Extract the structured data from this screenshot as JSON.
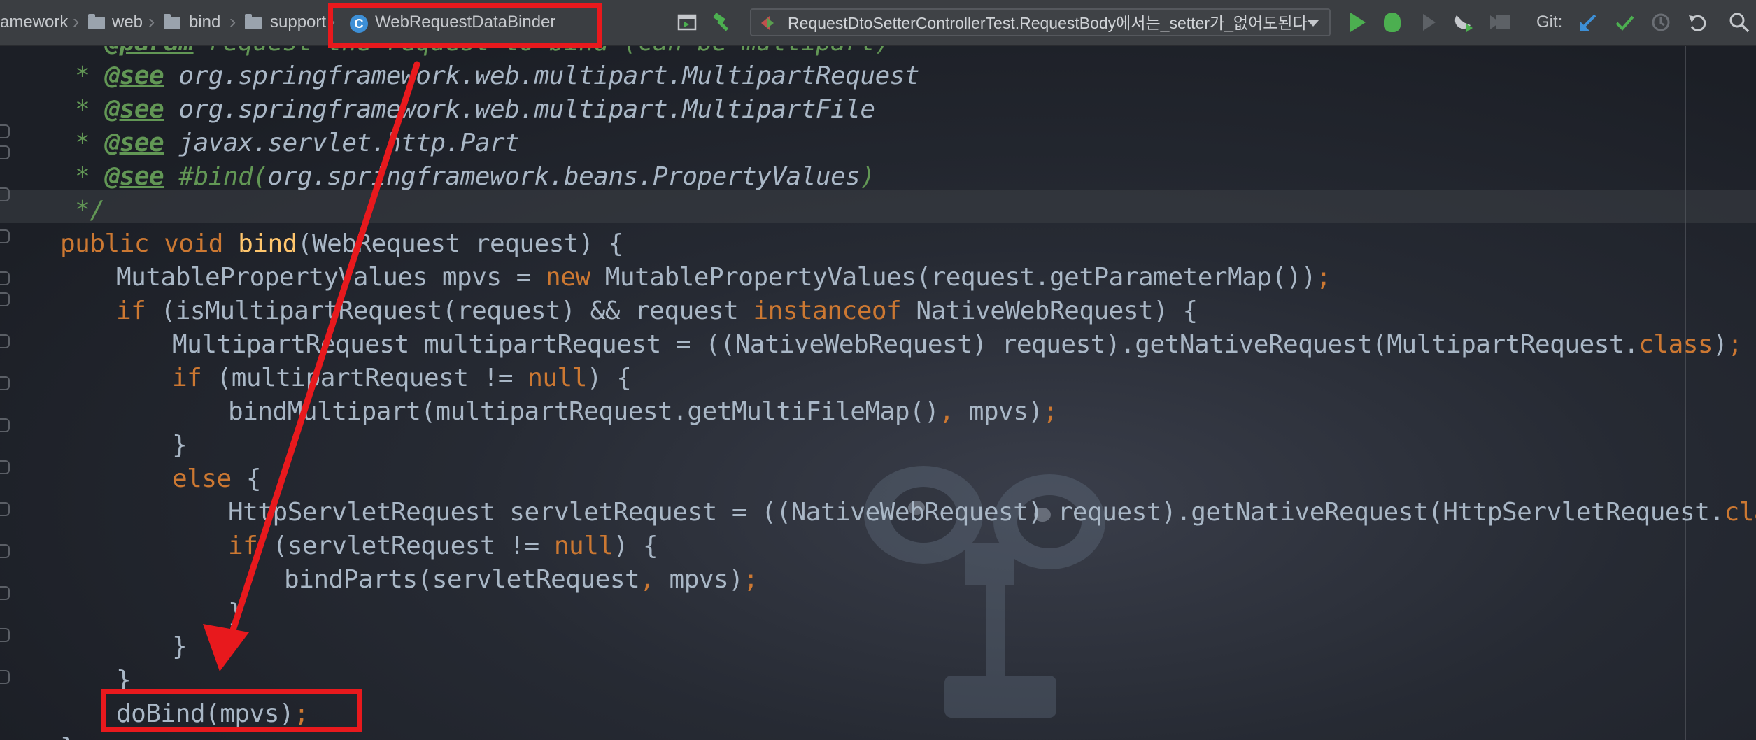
{
  "breadcrumbs": [
    {
      "label": "amework",
      "folder": false
    },
    {
      "label": "web",
      "folder": true
    },
    {
      "label": "bind",
      "folder": true
    },
    {
      "label": "support",
      "folder": true
    }
  ],
  "active_class": {
    "label": "WebRequestDataBinder",
    "icon": "class-icon",
    "icon_glyph": "C"
  },
  "toolbar": {
    "run_configuration": "RequestDtoSetterControllerTest.RequestBody에서는_setter가_없어도된다",
    "git_label": "Git:",
    "icons": [
      "layout-icon",
      "build-hammer-icon",
      "run-icon",
      "debug-icon",
      "run-coverage-icon",
      "profile-icon",
      "stop-icon",
      "git-update-icon",
      "git-commit-icon",
      "history-icon",
      "revert-icon",
      "search-icon"
    ]
  },
  "code_lines": [
    {
      "indent": 1,
      "tokens": [
        {
          "t": " * ",
          "c": "doc"
        },
        {
          "t": "@param",
          "c": "tag"
        },
        {
          "t": " request the request to bind (can be multipart)",
          "c": "doc"
        }
      ]
    },
    {
      "indent": 1,
      "tokens": [
        {
          "t": " * ",
          "c": "doc"
        },
        {
          "t": "@see",
          "c": "tag"
        },
        {
          "t": " org.springframework.web.multipart.MultipartRequest",
          "c": "ref"
        }
      ]
    },
    {
      "indent": 1,
      "tokens": [
        {
          "t": " * ",
          "c": "doc"
        },
        {
          "t": "@see",
          "c": "tag"
        },
        {
          "t": " org.springframework.web.multipart.MultipartFile",
          "c": "ref"
        }
      ]
    },
    {
      "indent": 1,
      "tokens": [
        {
          "t": " * ",
          "c": "doc"
        },
        {
          "t": "@see",
          "c": "tag"
        },
        {
          "t": " javax.servlet.http.Part",
          "c": "ref"
        }
      ]
    },
    {
      "indent": 1,
      "tokens": [
        {
          "t": " * ",
          "c": "doc"
        },
        {
          "t": "@see",
          "c": "tag"
        },
        {
          "t": " #bind",
          "c": "doc"
        },
        {
          "t": "(",
          "c": "doc"
        },
        {
          "t": "org.springframework.beans.PropertyValues",
          "c": "ref"
        },
        {
          "t": ")",
          "c": "doc"
        }
      ]
    },
    {
      "indent": 1,
      "tokens": [
        {
          "t": " */",
          "c": "doc"
        }
      ]
    },
    {
      "indent": 1,
      "tokens": [
        {
          "t": "public void ",
          "c": "kw"
        },
        {
          "t": "bind",
          "c": "fn"
        },
        {
          "t": "(WebRequest request) {",
          "c": "plain"
        }
      ]
    },
    {
      "indent": 2,
      "tokens": [
        {
          "t": "MutablePropertyValues mpvs = ",
          "c": "plain"
        },
        {
          "t": "new ",
          "c": "kw"
        },
        {
          "t": "MutablePropertyValues(request.getParameterMap())",
          "c": "plain"
        },
        {
          "t": ";",
          "c": "kw"
        }
      ]
    },
    {
      "indent": 2,
      "tokens": [
        {
          "t": "if ",
          "c": "kw"
        },
        {
          "t": "(isMultipartRequest(request) && request ",
          "c": "plain"
        },
        {
          "t": "instanceof ",
          "c": "kw"
        },
        {
          "t": "NativeWebRequest) {",
          "c": "plain"
        }
      ]
    },
    {
      "indent": 3,
      "tokens": [
        {
          "t": "MultipartRequest multipartRequest = ((NativeWebRequest) request).getNativeRequest(MultipartRequest.",
          "c": "plain"
        },
        {
          "t": "class",
          "c": "kw"
        },
        {
          "t": ")",
          "c": "plain"
        },
        {
          "t": ";",
          "c": "kw"
        }
      ]
    },
    {
      "indent": 3,
      "tokens": [
        {
          "t": "if ",
          "c": "kw"
        },
        {
          "t": "(multipartRequest != ",
          "c": "plain"
        },
        {
          "t": "null",
          "c": "kw"
        },
        {
          "t": ") {",
          "c": "plain"
        }
      ]
    },
    {
      "indent": 4,
      "tokens": [
        {
          "t": "bindMultipart(multipartRequest.getMultiFileMap()",
          "c": "plain"
        },
        {
          "t": ", ",
          "c": "kw"
        },
        {
          "t": "mpvs)",
          "c": "plain"
        },
        {
          "t": ";",
          "c": "kw"
        }
      ]
    },
    {
      "indent": 3,
      "tokens": [
        {
          "t": "}",
          "c": "plain"
        }
      ]
    },
    {
      "indent": 3,
      "tokens": [
        {
          "t": "else ",
          "c": "kw"
        },
        {
          "t": "{",
          "c": "plain"
        }
      ]
    },
    {
      "indent": 4,
      "tokens": [
        {
          "t": "HttpServletRequest servletRequest = ((NativeWebRequest) request).getNativeRequest(HttpServletRequest.",
          "c": "plain"
        },
        {
          "t": "class",
          "c": "kw"
        },
        {
          "t": ")",
          "c": "plain"
        },
        {
          "t": ";",
          "c": "kw"
        }
      ]
    },
    {
      "indent": 4,
      "tokens": [
        {
          "t": "if ",
          "c": "kw"
        },
        {
          "t": "(servletRequest != ",
          "c": "plain"
        },
        {
          "t": "null",
          "c": "kw"
        },
        {
          "t": ") {",
          "c": "plain"
        }
      ]
    },
    {
      "indent": 5,
      "tokens": [
        {
          "t": "bindParts(servletRequest",
          "c": "plain"
        },
        {
          "t": ", ",
          "c": "kw"
        },
        {
          "t": "mpvs)",
          "c": "plain"
        },
        {
          "t": ";",
          "c": "kw"
        }
      ]
    },
    {
      "indent": 4,
      "tokens": [
        {
          "t": "}",
          "c": "plain"
        }
      ]
    },
    {
      "indent": 3,
      "tokens": [
        {
          "t": "}",
          "c": "plain"
        }
      ]
    },
    {
      "indent": 2,
      "tokens": [
        {
          "t": "}",
          "c": "plain"
        }
      ]
    },
    {
      "indent": 2,
      "tokens": [
        {
          "t": "doBind(mpvs)",
          "c": "plain"
        },
        {
          "t": ";",
          "c": "kw"
        }
      ]
    },
    {
      "indent": 1,
      "tokens": [
        {
          "t": "}",
          "c": "plain"
        }
      ]
    }
  ],
  "annotations": {
    "highlight_color": "#e8191d",
    "boxes": [
      "active-class-tab",
      "dobind-call"
    ],
    "arrow": "from active class tab to doBind call"
  },
  "colors": {
    "keyword": "#cc7832",
    "function": "#ffc66d",
    "plain": "#a9b7c6",
    "doc": "#629755",
    "navbar": "#3b3e42"
  }
}
